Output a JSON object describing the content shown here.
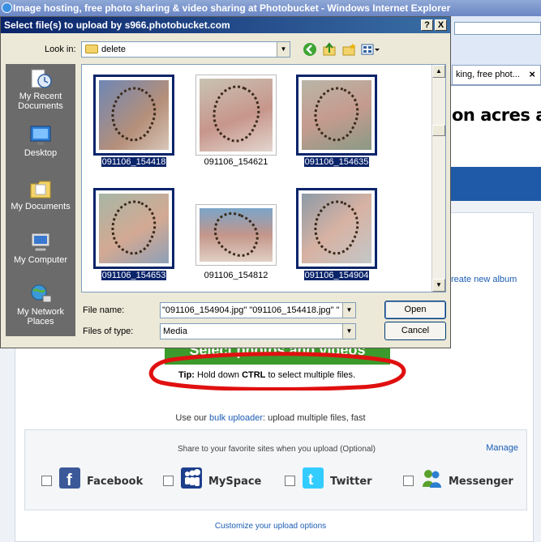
{
  "browser": {
    "title": "Image hosting, free photo sharing & video sharing at Photobucket - Windows Internet Explorer",
    "tab_label": "king, free phot...",
    "tab_close": "×",
    "headline": "on acres a y"
  },
  "dialog": {
    "title": "Select file(s) to upload by s966.photobucket.com",
    "help_btn": "?",
    "close_btn": "X",
    "look_in_label": "Look in:",
    "look_in_value": "delete",
    "file_name_label": "File name:",
    "file_name_value": "\"091106_154904.jpg\" \"091106_154418.jpg\" \"",
    "files_of_type_label": "Files of type:",
    "files_of_type_value": "Media",
    "open_label": "Open",
    "cancel_label": "Cancel",
    "places": [
      {
        "label": "My Recent Documents",
        "icon": "recent-documents-icon"
      },
      {
        "label": "Desktop",
        "icon": "desktop-icon"
      },
      {
        "label": "My Documents",
        "icon": "my-documents-icon"
      },
      {
        "label": "My Computer",
        "icon": "my-computer-icon"
      },
      {
        "label": "My Network Places",
        "icon": "network-places-icon"
      }
    ],
    "files": [
      {
        "name": "091106_154418",
        "selected": true
      },
      {
        "name": "091106_154621",
        "selected": false
      },
      {
        "name": "091106_154635",
        "selected": true
      },
      {
        "name": "091106_154653",
        "selected": true
      },
      {
        "name": "091106_154812",
        "selected": false
      },
      {
        "name": "091106_154904",
        "selected": true
      }
    ]
  },
  "page": {
    "new_album": "reate new album",
    "upload_button": "Select photos and videos",
    "tip_label": "Tip:",
    "tip_pre": "Hold down",
    "tip_key": "CTRL",
    "tip_post": "to select multiple files.",
    "bulk_pre": "Use our",
    "bulk_link": "bulk uploader",
    "bulk_post": ": upload multiple files, fast",
    "share_caption": "Share to your favorite sites when you upload (Optional)",
    "manage": "Manage",
    "share_sites": [
      {
        "name": "Facebook",
        "color": "#3b5998",
        "icon": "facebook-icon"
      },
      {
        "name": "MySpace",
        "color": "#1c3f8c",
        "icon": "myspace-icon"
      },
      {
        "name": "Twitter",
        "color": "#33ccff",
        "icon": "twitter-icon"
      },
      {
        "name": "Messenger",
        "color": "#5aa02c",
        "icon": "messenger-icon"
      }
    ],
    "customize": "Customize your upload options"
  },
  "colors": {
    "selection": "#0a246a",
    "link": "#1b5db4",
    "upload_green": "#3c9a2c",
    "annotation_red": "#e01010"
  }
}
